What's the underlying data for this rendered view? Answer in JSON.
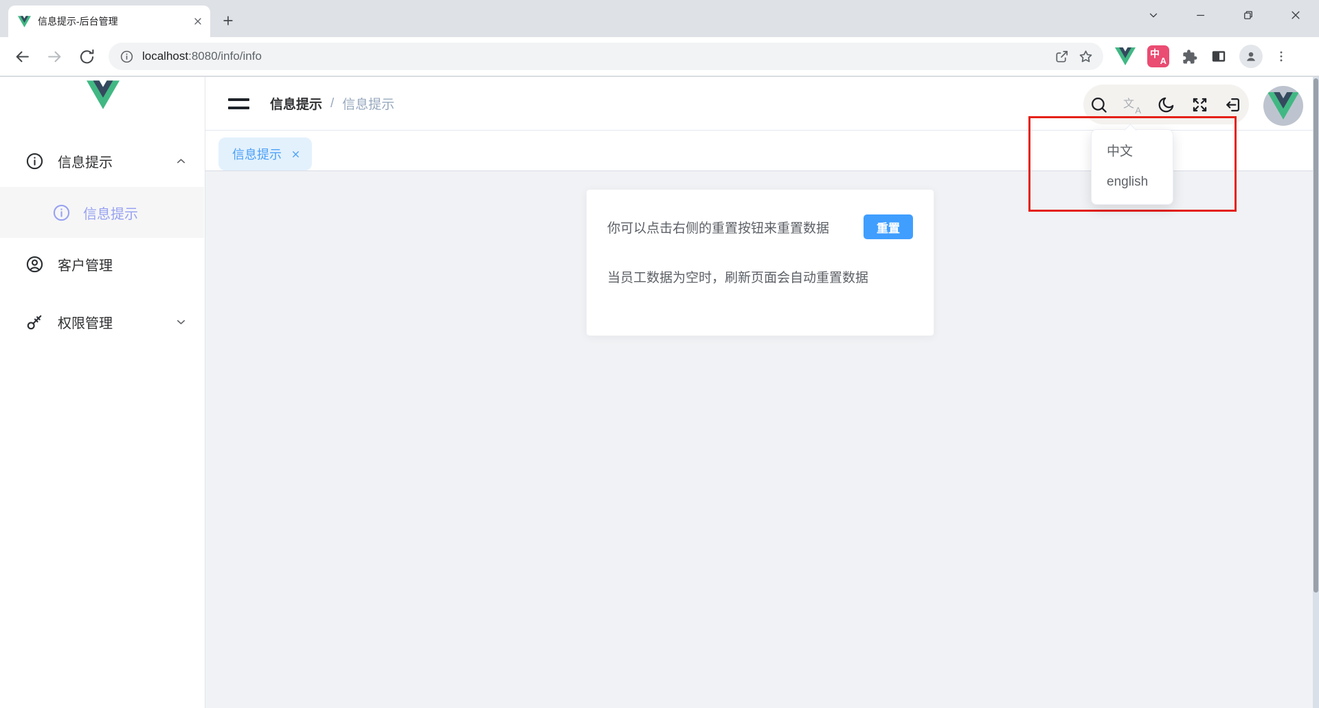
{
  "browser": {
    "tab_title": "信息提示-后台管理",
    "url_host": "localhost",
    "url_rest": ":8080/info/info"
  },
  "sidebar": {
    "items": [
      {
        "label": "信息提示",
        "state": "expanded"
      },
      {
        "label": "信息提示",
        "state": "active-submenu"
      },
      {
        "label": "客户管理",
        "state": "normal"
      },
      {
        "label": "权限管理",
        "state": "collapsed"
      }
    ]
  },
  "header": {
    "breadcrumb_root": "信息提示",
    "breadcrumb_separator": "/",
    "breadcrumb_current": "信息提示"
  },
  "tabbar": {
    "active_tab_label": "信息提示"
  },
  "card": {
    "line1": "你可以点击右侧的重置按钮来重置数据",
    "reset_button_label": "重置",
    "line2": "当员工数据为空时，刷新页面会自动重置数据"
  },
  "lang_menu": {
    "items": [
      {
        "label": "中文"
      },
      {
        "label": "english"
      }
    ]
  },
  "colors": {
    "accent_blue": "#409eff",
    "active_menu_text": "#98a2f1",
    "tab_chip_bg": "#e3f1fd",
    "content_bg": "#f0f2f5",
    "annotation_red": "#e52017"
  }
}
